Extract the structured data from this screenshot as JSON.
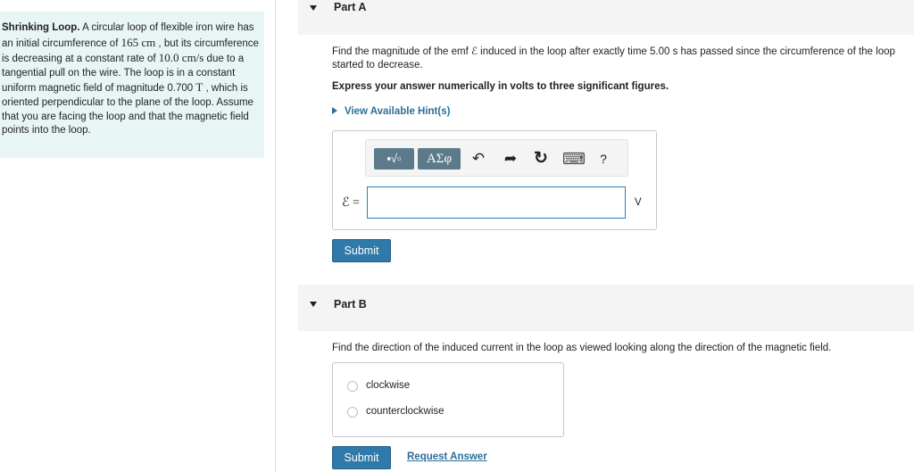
{
  "problem": {
    "title": "Shrinking Loop.",
    "text_1": " A circular loop of flexible iron wire has an initial circumference of ",
    "circumference": "165 cm",
    "text_2": " , but its circumference is decreasing at a constant rate of ",
    "rate": "10.0 cm/s",
    "text_3": " due to a tangential pull on the wire. The loop is in a constant uniform magnetic field of magnitude 0.700 ",
    "field_unit": "T",
    "text_4": " , which is oriented perpendicular to the plane of the loop. Assume that you are facing the loop and that the magnetic field points into the loop."
  },
  "part_a": {
    "title": "Part A",
    "question": "Find the magnitude of the emf ℰ induced in the loop after exactly time 5.00 s has passed since the circumference of the loop started to decrease.",
    "instruction": "Express your answer numerically in volts to three significant figures.",
    "hint_label": "View Available Hint(s)",
    "toolbar": {
      "templates_label": "▪√▫",
      "symbols_label": "ΑΣφ",
      "undo_icon": "↶",
      "redo_icon": "➦",
      "reset_icon": "↻",
      "keyboard_icon": "⌨",
      "help_icon": "?"
    },
    "symbol": "ℰ =",
    "answer_value": "",
    "unit": "V",
    "submit_label": "Submit"
  },
  "part_b": {
    "title": "Part B",
    "question": "Find the direction of the induced current in the loop as viewed looking along the direction of the magnetic field.",
    "choices": [
      "clockwise",
      "counterclockwise"
    ],
    "submit_label": "Submit",
    "request_label": "Request Answer"
  }
}
